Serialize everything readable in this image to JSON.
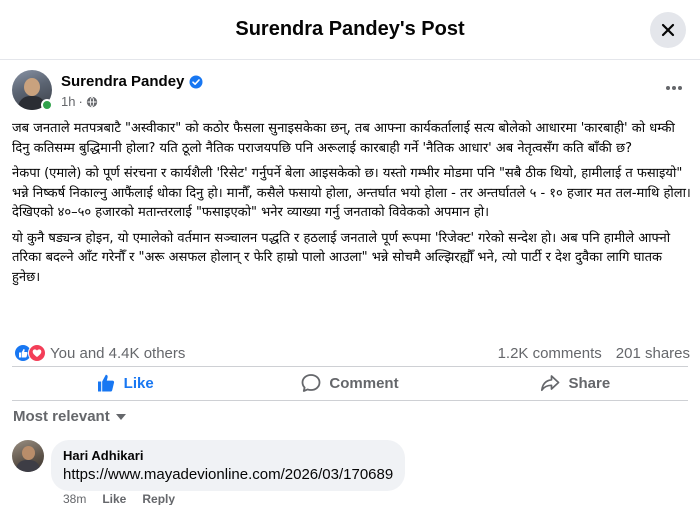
{
  "header": {
    "title": "Surendra Pandey's Post"
  },
  "post": {
    "author": "Surendra Pandey",
    "time": "1h",
    "time_separator": "·",
    "paragraphs": [
      "जब जनताले मतपत्रबाटै \"अस्वीकार\" को कठोर फैसला सुनाइसकेका छन्, तब आफ्ना कार्यकर्तालाई सत्य बोलेको आधारमा 'कारबाही' को धम्की दिनु कतिसम्म बुद्धिमानी होला? यति ठूलो नैतिक पराजयपछि पनि अरूलाई कारबाही गर्ने 'नैतिक आधार' अब नेतृत्वसँग कति बाँकी छ?",
      "नेकपा (एमाले) को पूर्ण संरचना र कार्यशैली 'रिसेट' गर्नुपर्ने बेला आइसकेको छ। यस्तो गम्भीर मोडमा पनि \"सबै ठीक थियो, हामीलाई त फसाइयो\" भन्ने निष्कर्ष निकाल्नु आफैंलाई धोका दिनु हो। मानौँ, कसैले फसायो होला, अन्तर्घात भयो होला - तर अन्तर्घातले ५ - १० हजार मत तल-माथि होला। देखिएको ४०–५० हजारको मतान्तरलाई \"फसाइएको\" भनेर व्याख्या गर्नु जनताको विवेकको अपमान हो।",
      "यो कुनै षड्यन्त्र होइन, यो एमालेको वर्तमान सञ्चालन पद्धति र हठलाई जनताले पूर्ण रूपमा 'रिजेक्ट' गरेको सन्देश हो। अब पनि हामीले आफ्नो तरिका बदल्ने आँट गरेनौँ र \"अरू असफल होलान् र फेरि हाम्रो पालो आउला\" भन्ने सोचमै अल्झिरह्यौँ भने, त्यो पार्टी र देश दुवैका लागि घातक हुनेछ।"
    ]
  },
  "reactions": {
    "summary": "You and 4.4K others",
    "comments": "1.2K comments",
    "shares": "201 shares",
    "icons": [
      "like-icon",
      "love-icon"
    ]
  },
  "actions": {
    "like": "Like",
    "comment": "Comment",
    "share": "Share"
  },
  "sort": {
    "label": "Most relevant"
  },
  "comments": [
    {
      "author": "Hari Adhikari",
      "text": "https://www.mayadevionline.com/2026/03/170689",
      "time": "38m",
      "like": "Like",
      "reply": "Reply"
    }
  ],
  "colors": {
    "accent": "#1877f2",
    "love": "#f33e58",
    "online": "#31a24c",
    "muted": "#65676b"
  }
}
